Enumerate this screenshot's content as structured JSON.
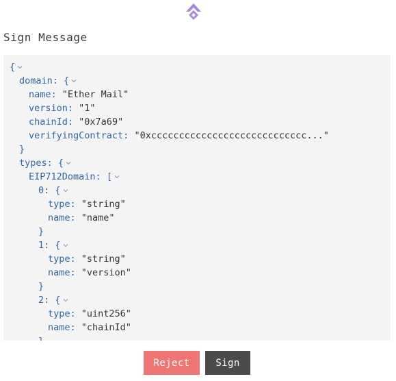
{
  "app": {
    "logo_icon": "arbitrum-logo-icon",
    "brand_color": "#a685dd"
  },
  "header": {
    "title": "Sign Message"
  },
  "json_view": {
    "lines": [
      {
        "indent": 0,
        "key": "",
        "sep": "",
        "value": "",
        "open": "{",
        "collapse": true,
        "kind": "open"
      },
      {
        "indent": 1,
        "key": "domain",
        "sep": ": ",
        "value": "",
        "open": "{",
        "collapse": true,
        "kind": "open"
      },
      {
        "indent": 2,
        "key": "name",
        "sep": ": ",
        "value": "\"Ether Mail\"",
        "open": "",
        "collapse": false,
        "kind": "pair"
      },
      {
        "indent": 2,
        "key": "version",
        "sep": ": ",
        "value": "\"1\"",
        "open": "",
        "collapse": false,
        "kind": "pair"
      },
      {
        "indent": 2,
        "key": "chainId",
        "sep": ": ",
        "value": "\"0x7a69\"",
        "open": "",
        "collapse": false,
        "kind": "pair"
      },
      {
        "indent": 2,
        "key": "verifyingContract",
        "sep": ": ",
        "value": "\"0xcccccccccccccccccccccccccccc...\"",
        "open": "",
        "collapse": false,
        "kind": "pair"
      },
      {
        "indent": 1,
        "key": "",
        "sep": "",
        "value": "",
        "open": "}",
        "collapse": false,
        "kind": "close"
      },
      {
        "indent": 1,
        "key": "types",
        "sep": ": ",
        "value": "",
        "open": "{",
        "collapse": true,
        "kind": "open"
      },
      {
        "indent": 2,
        "key": "EIP712Domain",
        "sep": ": ",
        "value": "",
        "open": "[",
        "collapse": true,
        "kind": "open"
      },
      {
        "indent": 3,
        "key": "0",
        "sep": ": ",
        "value": "",
        "open": "{",
        "collapse": true,
        "kind": "open"
      },
      {
        "indent": 4,
        "key": "type",
        "sep": ": ",
        "value": "\"string\"",
        "open": "",
        "collapse": false,
        "kind": "pair"
      },
      {
        "indent": 4,
        "key": "name",
        "sep": ": ",
        "value": "\"name\"",
        "open": "",
        "collapse": false,
        "kind": "pair"
      },
      {
        "indent": 3,
        "key": "",
        "sep": "",
        "value": "",
        "open": "}",
        "collapse": false,
        "kind": "close"
      },
      {
        "indent": 3,
        "key": "1",
        "sep": ": ",
        "value": "",
        "open": "{",
        "collapse": true,
        "kind": "open"
      },
      {
        "indent": 4,
        "key": "type",
        "sep": ": ",
        "value": "\"string\"",
        "open": "",
        "collapse": false,
        "kind": "pair"
      },
      {
        "indent": 4,
        "key": "name",
        "sep": ": ",
        "value": "\"version\"",
        "open": "",
        "collapse": false,
        "kind": "pair"
      },
      {
        "indent": 3,
        "key": "",
        "sep": "",
        "value": "",
        "open": "}",
        "collapse": false,
        "kind": "close"
      },
      {
        "indent": 3,
        "key": "2",
        "sep": ": ",
        "value": "",
        "open": "{",
        "collapse": true,
        "kind": "open"
      },
      {
        "indent": 4,
        "key": "type",
        "sep": ": ",
        "value": "\"uint256\"",
        "open": "",
        "collapse": false,
        "kind": "pair"
      },
      {
        "indent": 4,
        "key": "name",
        "sep": ": ",
        "value": "\"chainId\"",
        "open": "",
        "collapse": false,
        "kind": "pair"
      },
      {
        "indent": 3,
        "key": "",
        "sep": "",
        "value": "",
        "open": "}",
        "collapse": false,
        "kind": "close"
      }
    ],
    "key_color": "#2f66a3",
    "value_color": "#333333",
    "collapse_icon": "chevron-down-icon"
  },
  "actions": {
    "reject_label": "Reject",
    "sign_label": "Sign",
    "reject_color": "#ef7474",
    "sign_color": "#4b4b4b"
  }
}
